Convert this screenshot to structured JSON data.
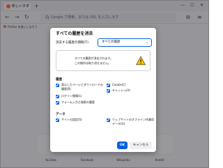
{
  "browser": {
    "tab_title": "新しいタブ",
    "tab_close": "×",
    "new_tab": "+",
    "minimize": "—",
    "maximize": "☐",
    "close": "✕",
    "back": "←",
    "forward": "→",
    "reload": "↻",
    "url_placeholder": "Google で検索、または URL を入力します",
    "search_icon": "search-icon",
    "menu": "≡",
    "extensions": "⧉",
    "bookmark_label": "Firefox を使いこなそう"
  },
  "shortcuts": [
    "YouTube",
    "Facebook",
    "Wikipedia",
    "Reddit"
  ],
  "dialog": {
    "title": "すべての履歴を消去",
    "range_label": "消去する履歴の期間(T):",
    "range_value": "すべての履歴",
    "warning_line1": "すべての履歴が消去されます。",
    "warning_line2": "この操作は取り消せません。",
    "history_heading": "履歴",
    "history_items": [
      "表示したページとダウンロードの履歴(B)",
      "検索語句やアドレス入力の履歴(F)",
      "ログイン情報(L)",
      "フォーム入力と検索の履歴",
      "Cookie(C)",
      "キャッシュ(A)"
    ],
    "data_heading": "データ",
    "data_items": [
      "サイトの設定(S)",
      "ウェブサイトのオフライン作業用データ(O)"
    ],
    "ok_label": "OK",
    "cancel_label": "キャンセル"
  },
  "colors": {
    "accent": "#0061e0",
    "warning": "#ffbf00"
  }
}
